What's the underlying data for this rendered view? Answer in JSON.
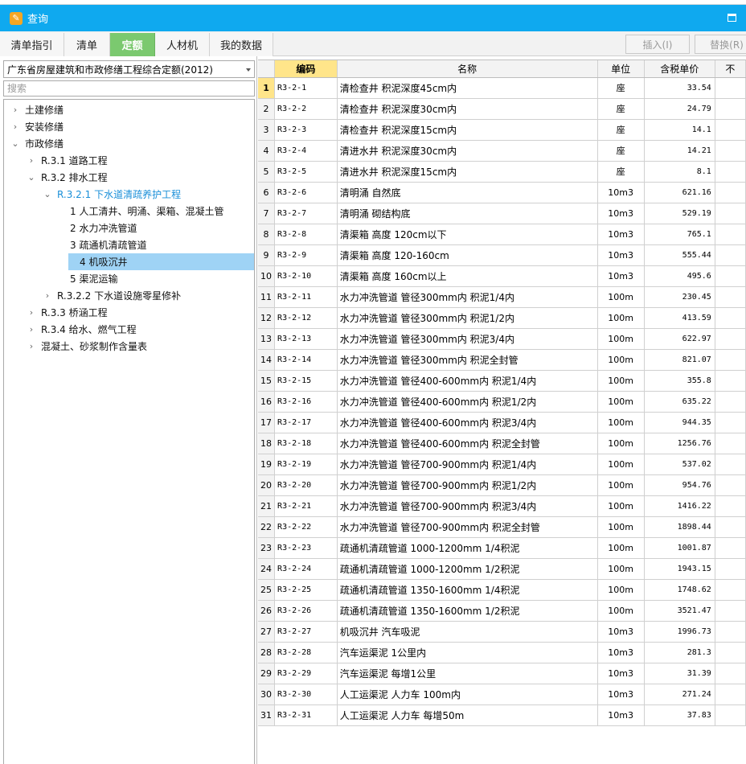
{
  "window": {
    "title": "查询"
  },
  "tabs": [
    {
      "label": "清单指引"
    },
    {
      "label": "清单"
    },
    {
      "label": "定额"
    },
    {
      "label": "人材机"
    },
    {
      "label": "我的数据"
    }
  ],
  "toolbar": {
    "insert_label": "插入(I)",
    "replace_label": "替换(R)"
  },
  "left": {
    "library": "广东省房屋建筑和市政修缮工程综合定额(2012)",
    "search_placeholder": "搜索"
  },
  "tree": [
    {
      "label": "土建修缮",
      "chev": "›"
    },
    {
      "label": "安装修缮",
      "chev": "›"
    },
    {
      "label": "市政修缮",
      "chev": "⌄"
    },
    {
      "label": "R.3.1 道路工程",
      "chev": "›"
    },
    {
      "label": "R.3.2 排水工程",
      "chev": "⌄"
    },
    {
      "label": "R.3.2.1 下水道清疏养护工程",
      "chev": "⌄"
    },
    {
      "label": "1 人工清井、明涌、渠箱、混凝土管",
      "chev": ""
    },
    {
      "label": "2 水力冲洗管道",
      "chev": ""
    },
    {
      "label": "3 疏通机清疏管道",
      "chev": ""
    },
    {
      "label": "4 机吸沉井",
      "chev": ""
    },
    {
      "label": "5 渠泥运输",
      "chev": ""
    },
    {
      "label": "R.3.2.2 下水道设施零星修补",
      "chev": "›"
    },
    {
      "label": "R.3.3 桥涵工程",
      "chev": "›"
    },
    {
      "label": "R.3.4 给水、燃气工程",
      "chev": "›"
    },
    {
      "label": "混凝土、砂浆制作含量表",
      "chev": "›"
    }
  ],
  "grid": {
    "headers": {
      "code": "编码",
      "name": "名称",
      "unit": "单位",
      "price": "含税单价",
      "extra": "不"
    },
    "rows": [
      {
        "n": "1",
        "code": "R3-2-1",
        "name": "清检查井 积泥深度45cm内",
        "unit": "座",
        "price": "33.54"
      },
      {
        "n": "2",
        "code": "R3-2-2",
        "name": "清检查井 积泥深度30cm内",
        "unit": "座",
        "price": "24.79"
      },
      {
        "n": "3",
        "code": "R3-2-3",
        "name": "清检查井 积泥深度15cm内",
        "unit": "座",
        "price": "14.1"
      },
      {
        "n": "4",
        "code": "R3-2-4",
        "name": "清进水井 积泥深度30cm内",
        "unit": "座",
        "price": "14.21"
      },
      {
        "n": "5",
        "code": "R3-2-5",
        "name": "清进水井 积泥深度15cm内",
        "unit": "座",
        "price": "8.1"
      },
      {
        "n": "6",
        "code": "R3-2-6",
        "name": "清明涌 自然底",
        "unit": "10m3",
        "price": "621.16"
      },
      {
        "n": "7",
        "code": "R3-2-7",
        "name": "清明涌 砌结构底",
        "unit": "10m3",
        "price": "529.19"
      },
      {
        "n": "8",
        "code": "R3-2-8",
        "name": "清渠箱 高度 120cm以下",
        "unit": "10m3",
        "price": "765.1"
      },
      {
        "n": "9",
        "code": "R3-2-9",
        "name": "清渠箱 高度 120-160cm",
        "unit": "10m3",
        "price": "555.44"
      },
      {
        "n": "10",
        "code": "R3-2-10",
        "name": "清渠箱 高度 160cm以上",
        "unit": "10m3",
        "price": "495.6"
      },
      {
        "n": "11",
        "code": "R3-2-11",
        "name": "水力冲洗管道 管径300mm内 积泥1/4内",
        "unit": "100m",
        "price": "230.45"
      },
      {
        "n": "12",
        "code": "R3-2-12",
        "name": "水力冲洗管道 管径300mm内 积泥1/2内",
        "unit": "100m",
        "price": "413.59"
      },
      {
        "n": "13",
        "code": "R3-2-13",
        "name": "水力冲洗管道 管径300mm内 积泥3/4内",
        "unit": "100m",
        "price": "622.97"
      },
      {
        "n": "14",
        "code": "R3-2-14",
        "name": "水力冲洗管道 管径300mm内 积泥全封管",
        "unit": "100m",
        "price": "821.07"
      },
      {
        "n": "15",
        "code": "R3-2-15",
        "name": "水力冲洗管道 管径400-600mm内 积泥1/4内",
        "unit": "100m",
        "price": "355.8"
      },
      {
        "n": "16",
        "code": "R3-2-16",
        "name": "水力冲洗管道 管径400-600mm内 积泥1/2内",
        "unit": "100m",
        "price": "635.22"
      },
      {
        "n": "17",
        "code": "R3-2-17",
        "name": "水力冲洗管道 管径400-600mm内 积泥3/4内",
        "unit": "100m",
        "price": "944.35"
      },
      {
        "n": "18",
        "code": "R3-2-18",
        "name": "水力冲洗管道 管径400-600mm内 积泥全封管",
        "unit": "100m",
        "price": "1256.76"
      },
      {
        "n": "19",
        "code": "R3-2-19",
        "name": "水力冲洗管道 管径700-900mm内 积泥1/4内",
        "unit": "100m",
        "price": "537.02"
      },
      {
        "n": "20",
        "code": "R3-2-20",
        "name": "水力冲洗管道 管径700-900mm内 积泥1/2内",
        "unit": "100m",
        "price": "954.76"
      },
      {
        "n": "21",
        "code": "R3-2-21",
        "name": "水力冲洗管道 管径700-900mm内 积泥3/4内",
        "unit": "100m",
        "price": "1416.22"
      },
      {
        "n": "22",
        "code": "R3-2-22",
        "name": "水力冲洗管道 管径700-900mm内 积泥全封管",
        "unit": "100m",
        "price": "1898.44"
      },
      {
        "n": "23",
        "code": "R3-2-23",
        "name": "疏通机清疏管道 1000-1200mm 1/4积泥",
        "unit": "100m",
        "price": "1001.87"
      },
      {
        "n": "24",
        "code": "R3-2-24",
        "name": "疏通机清疏管道 1000-1200mm 1/2积泥",
        "unit": "100m",
        "price": "1943.15"
      },
      {
        "n": "25",
        "code": "R3-2-25",
        "name": "疏通机清疏管道 1350-1600mm 1/4积泥",
        "unit": "100m",
        "price": "1748.62"
      },
      {
        "n": "26",
        "code": "R3-2-26",
        "name": "疏通机清疏管道 1350-1600mm 1/2积泥",
        "unit": "100m",
        "price": "3521.47"
      },
      {
        "n": "27",
        "code": "R3-2-27",
        "name": "机吸沉井 汽车吸泥",
        "unit": "10m3",
        "price": "1996.73"
      },
      {
        "n": "28",
        "code": "R3-2-28",
        "name": "汽车运渠泥 1公里内",
        "unit": "10m3",
        "price": "281.3"
      },
      {
        "n": "29",
        "code": "R3-2-29",
        "name": "汽车运渠泥 每增1公里",
        "unit": "10m3",
        "price": "31.39"
      },
      {
        "n": "30",
        "code": "R3-2-30",
        "name": "人工运渠泥 人力车 100m内",
        "unit": "10m3",
        "price": "271.24"
      },
      {
        "n": "31",
        "code": "R3-2-31",
        "name": "人工运渠泥 人力车 每增50m",
        "unit": "10m3",
        "price": "37.83"
      }
    ]
  }
}
